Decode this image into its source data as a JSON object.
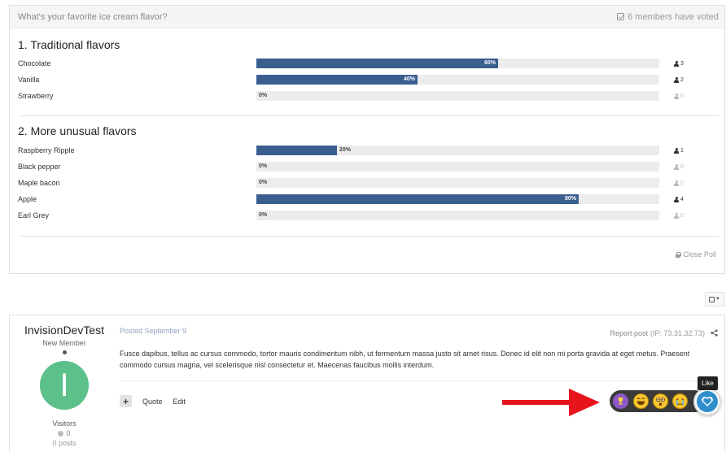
{
  "poll": {
    "question": "What's your favorite ice cream flavor?",
    "votes_text": "6 members have voted",
    "close_label": "Close Poll",
    "sections": [
      {
        "title": "1. Traditional flavors",
        "options": [
          {
            "label": "Chocolate",
            "percent": 60,
            "percent_text": "60%",
            "count": "3"
          },
          {
            "label": "Vanilla",
            "percent": 40,
            "percent_text": "40%",
            "count": "2"
          },
          {
            "label": "Strawberry",
            "percent": 0,
            "percent_text": "0%",
            "count": "0"
          }
        ]
      },
      {
        "title": "2. More unusual flavors",
        "options": [
          {
            "label": "Raspberry Ripple",
            "percent": 20,
            "percent_text": "20%",
            "count": "1"
          },
          {
            "label": "Black pepper",
            "percent": 0,
            "percent_text": "0%",
            "count": "0"
          },
          {
            "label": "Maple bacon",
            "percent": 0,
            "percent_text": "0%",
            "count": "0"
          },
          {
            "label": "Apple",
            "percent": 80,
            "percent_text": "80%",
            "count": "4"
          },
          {
            "label": "Earl Grey",
            "percent": 0,
            "percent_text": "0%",
            "count": "0"
          }
        ]
      }
    ]
  },
  "post": {
    "author": {
      "name": "InvisionDevTest",
      "rank": "New Member",
      "avatar_letter": "I",
      "avatar_color": "#5bc08a",
      "group": "Visitors",
      "reputation": "0",
      "posts": "0 posts"
    },
    "date": "Posted September 9",
    "report_label": "Report post",
    "ip": "(IP: 73.31.32.73)",
    "content": "Fusce dapibus, tellus ac cursus commodo, tortor mauris condimentum nibh, ut fermentum massa justo sit amet risus. Donec id elit non mi porta gravida at eget metus. Praesent commodo cursus magna, vel scelerisque nisl consectetur et. Maecenas faucibus mollis interdum.",
    "actions": {
      "quote_label": "Quote",
      "edit_label": "Edit"
    },
    "reactions": [
      "trophy-icon",
      "laughing-face-icon",
      "surprised-face-icon",
      "crying-face-icon",
      "heart-icon"
    ],
    "like_tooltip": "Like"
  },
  "colors": {
    "bar_fill": "#3a5f8f",
    "bar_track": "#ececec",
    "arrow": "#e8141b",
    "like": "#2f8ecb"
  }
}
